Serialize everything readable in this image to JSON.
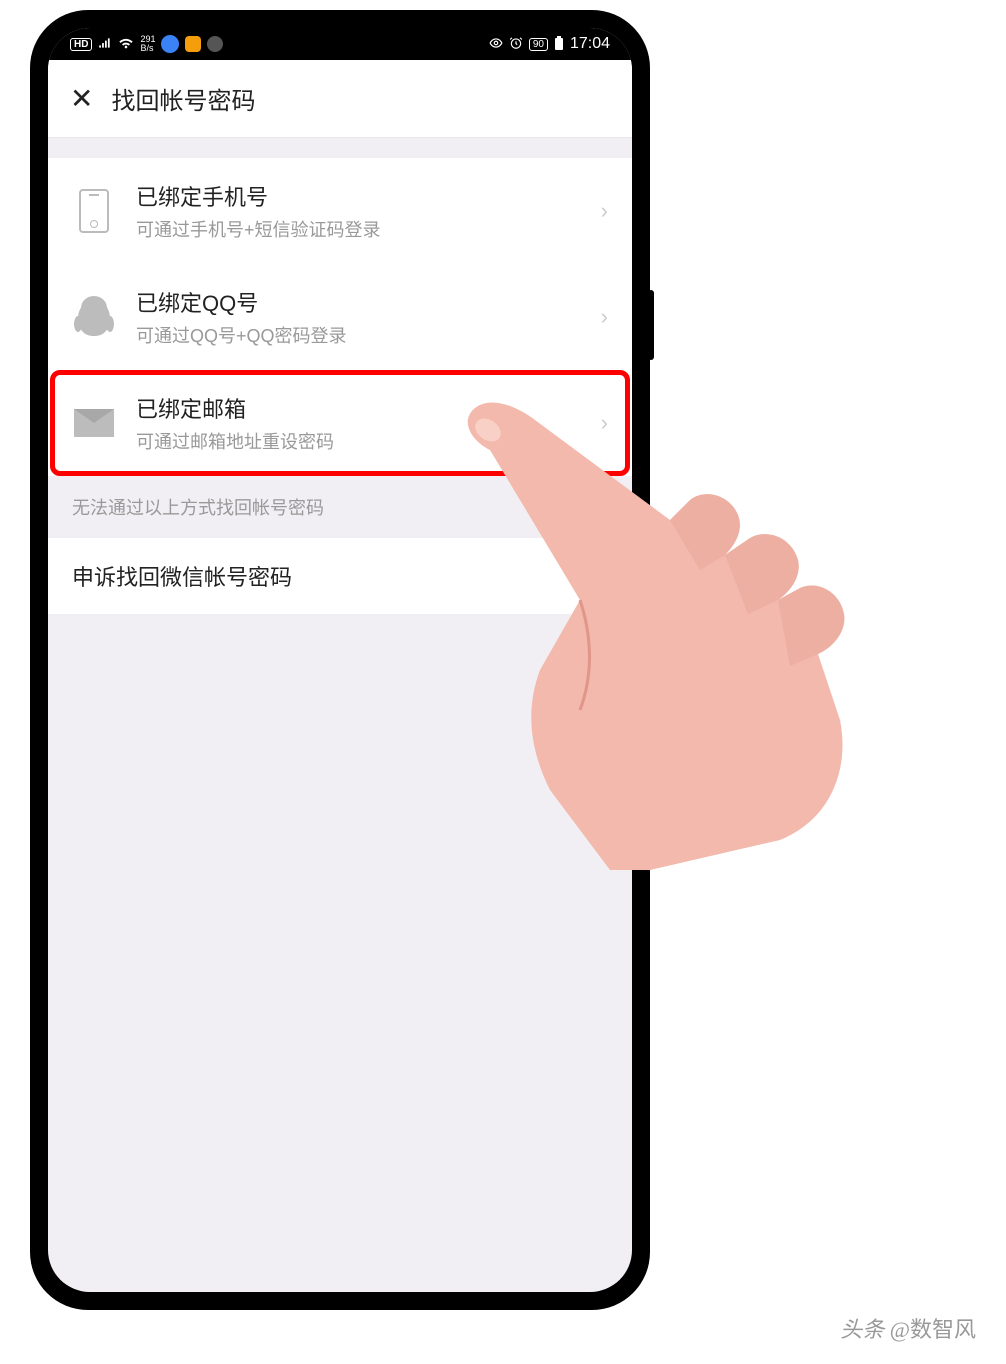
{
  "status_bar": {
    "hd": "HD",
    "speed_up": "291",
    "speed_unit": "B/s",
    "battery_pct": "90",
    "time": "17:04"
  },
  "nav": {
    "title": "找回帐号密码"
  },
  "options": [
    {
      "title": "已绑定手机号",
      "sub": "可通过手机号+短信验证码登录",
      "icon": "phone-icon"
    },
    {
      "title": "已绑定QQ号",
      "sub": "可通过QQ号+QQ密码登录",
      "icon": "qq-icon"
    },
    {
      "title": "已绑定邮箱",
      "sub": "可通过邮箱地址重设密码",
      "icon": "mail-icon",
      "highlighted": true
    }
  ],
  "section_label": "无法通过以上方式找回帐号密码",
  "appeal": "申诉找回微信帐号密码",
  "watermark": {
    "prefix": "头条",
    "handle": "@数智风"
  }
}
